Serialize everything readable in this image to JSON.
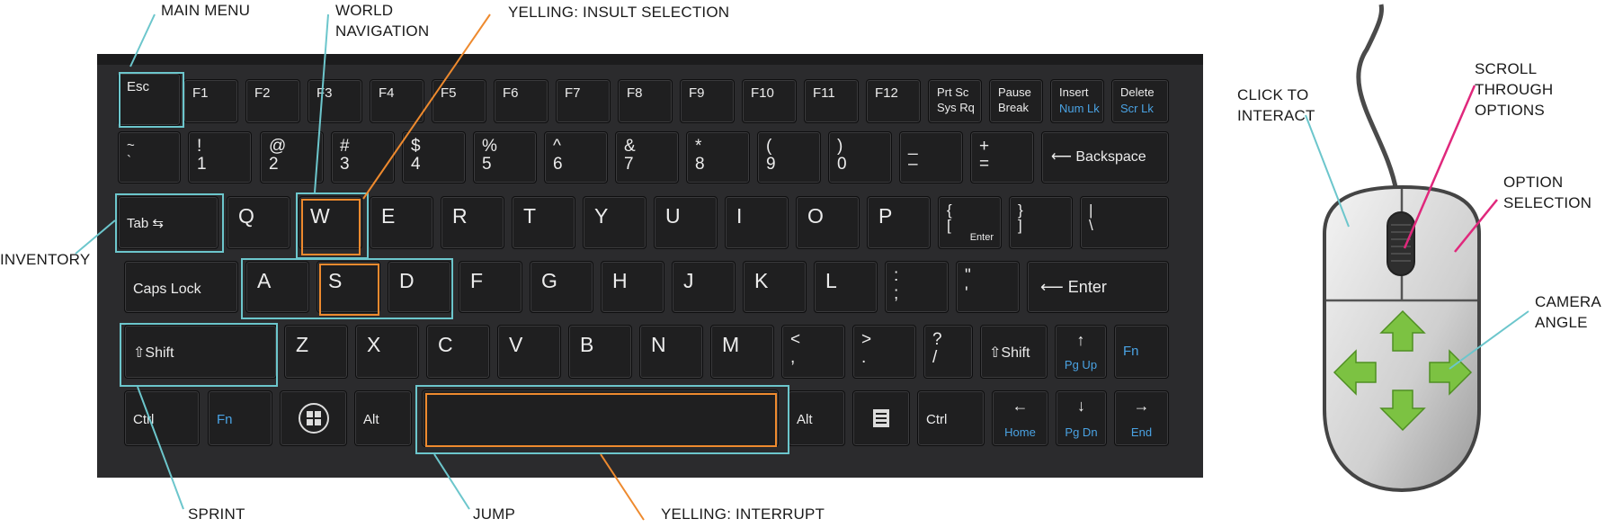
{
  "labels": {
    "main_menu": "MAIN MENU",
    "world_navigation_1": "WORLD",
    "world_navigation_2": "NAVIGATION",
    "yelling_insult": "YELLING: INSULT SELECTION",
    "inventory": "INVENTORY",
    "sprint": "SPRINT",
    "jump": "JUMP",
    "yelling_interrupt": "YELLING: INTERRUPT",
    "click_1": "CLICK TO",
    "click_2": "INTERACT",
    "scroll_1": "SCROLL",
    "scroll_2": "THROUGH",
    "scroll_3": "OPTIONS",
    "option_1": "OPTION",
    "option_2": "SELECTION",
    "camera_1": "CAMERA",
    "camera_2": "ANGLE"
  },
  "keys": {
    "esc": "Esc",
    "f1": "F1",
    "f2": "F2",
    "f3": "F3",
    "f4": "F4",
    "f5": "F5",
    "f6": "F6",
    "f7": "F7",
    "f8": "F8",
    "f9": "F9",
    "f10": "F10",
    "f11": "F11",
    "f12": "F12",
    "prtsc": "Prt Sc\nSys Rq",
    "pause": "Pause\nBreak",
    "insert": "Insert",
    "numlk": "Num Lk",
    "delete": "Delete",
    "scrlk": "Scr Lk",
    "tilde": "~\n`",
    "n1": "!\n1",
    "n2": "@\n2",
    "n3": "#\n3",
    "n4": "$\n4",
    "n5": "%\n5",
    "n6": "^\n6",
    "n7": "&\n7",
    "n8": "*\n8",
    "n9": "(\n9",
    "n0": ")\n0",
    "minus": "_\n–",
    "equals": "+\n=",
    "backspace": "⟵ Backspace",
    "tab": "Tab ⇆",
    "q": "Q",
    "w": "W",
    "e": "E",
    "r": "R",
    "t": "T",
    "y": "Y",
    "u": "U",
    "i": "I",
    "o": "O",
    "p": "P",
    "lbrace": "{\n[",
    "enter_small": "Enter",
    "rbrace": "}\n]",
    "pipe": "|\n\\",
    "capslock": "Caps Lock",
    "a": "A",
    "s": "S",
    "d": "D",
    "f": "F",
    "g": "G",
    "h": "H",
    "j": "J",
    "k": "K",
    "l": "L",
    "semicolon": ":\n;",
    "quote": "\"\n'",
    "enter": "⟵ Enter",
    "lshift": "⇧Shift",
    "z": "Z",
    "x": "X",
    "c": "C",
    "v": "V",
    "b": "B",
    "n": "N",
    "m": "M",
    "comma": "<\n,",
    "period": ">\n.",
    "slash": "?\n/",
    "rshift": "⇧Shift",
    "pgup_arrow": "↑",
    "pgup": "Pg Up",
    "fn": "Fn",
    "ctrl": "Ctrl",
    "fn2": "Fn",
    "alt": "Alt",
    "alt_r": "Alt",
    "ctrl_r": "Ctrl",
    "home_arrow": "←",
    "home": "Home",
    "pgdn_arrow": "↓",
    "pgdn": "Pg Dn",
    "end_arrow": "→",
    "end": "End"
  },
  "colors": {
    "teal": "#6cc6cc",
    "orange": "#ee8a2e",
    "pink": "#e0287c",
    "keyboard": "#2b2b2d",
    "key": "#1f1f20",
    "mouse_body": "#cfcfcf",
    "arrow_green": "#7cc242"
  }
}
